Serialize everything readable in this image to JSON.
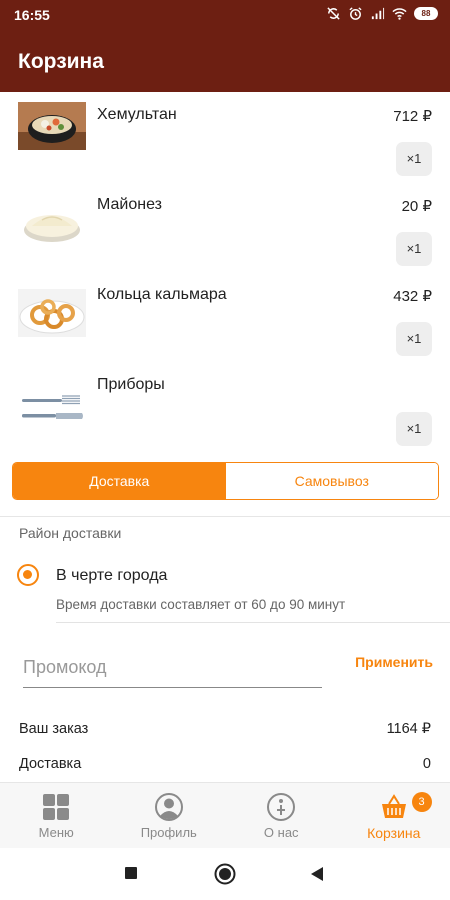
{
  "status_bar": {
    "time": "16:55",
    "battery": "88",
    "icons": [
      "sync-off-icon",
      "alarm-icon",
      "signal-icon",
      "wifi-icon",
      "battery-icon"
    ]
  },
  "app_bar": {
    "title": "Корзина"
  },
  "cart": {
    "items": [
      {
        "name": "Хемультан",
        "price": "712 ₽",
        "qty": "×1",
        "image": "hemultan-dish-photo"
      },
      {
        "name": "Майонез",
        "price": "20 ₽",
        "qty": "×1",
        "image": "mayonnaise-photo"
      },
      {
        "name": "Кольца кальмара",
        "price": "432 ₽",
        "qty": "×1",
        "image": "squid-rings-photo"
      },
      {
        "name": "Приборы",
        "price": "",
        "qty": "×1",
        "image": "cutlery-photo"
      }
    ]
  },
  "delivery_toggle": {
    "delivery": "Доставка",
    "pickup": "Самовывоз",
    "selected": "delivery"
  },
  "delivery_area": {
    "label": "Район доставки",
    "option": "В черте города",
    "description": "Время доставки составляет от 60 до 90 минут"
  },
  "promo": {
    "placeholder": "Промокод",
    "apply": "Применить"
  },
  "summary": {
    "order_label": "Ваш заказ",
    "order_value": "1164 ₽",
    "delivery_label": "Доставка",
    "delivery_value": "0"
  },
  "bottom_nav": {
    "items": [
      {
        "label": "Меню",
        "icon": "grid-icon"
      },
      {
        "label": "Профиль",
        "icon": "profile-icon"
      },
      {
        "label": "О нас",
        "icon": "info-icon"
      },
      {
        "label": "Корзина",
        "icon": "basket-icon",
        "badge": "3"
      }
    ],
    "active": "Корзина"
  },
  "colors": {
    "brand": "#6d1f12",
    "accent": "#f7850f"
  }
}
